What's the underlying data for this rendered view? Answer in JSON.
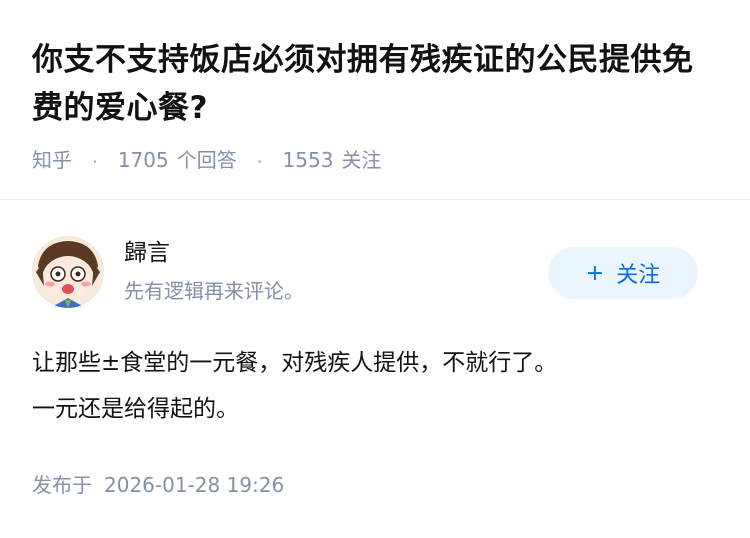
{
  "question": {
    "title": "你支不支持饭店必须对拥有残疾证的公民提供免费的爱心餐?",
    "source": "知乎",
    "answer_count": "1705",
    "answer_label": "个回答",
    "follower_count": "1553",
    "follower_label": "关注"
  },
  "answer": {
    "author": {
      "name": "歸言",
      "bio": "先有逻辑再来评论。",
      "avatar_icon": "anime-avatar-icon"
    },
    "follow_button": {
      "icon": "+",
      "label": "关注"
    },
    "paragraphs": [
      "让那些±食堂的一元餐，对残疾人提供，不就行了。",
      "一元还是给得起的。"
    ],
    "published_label": "发布于",
    "published_time": "2026-01-28 19:26"
  },
  "colors": {
    "title": "#121212",
    "meta": "#8590a6",
    "accent": "#056de8",
    "follow_bg": "#ebf5ff",
    "divider": "#ebebeb"
  }
}
